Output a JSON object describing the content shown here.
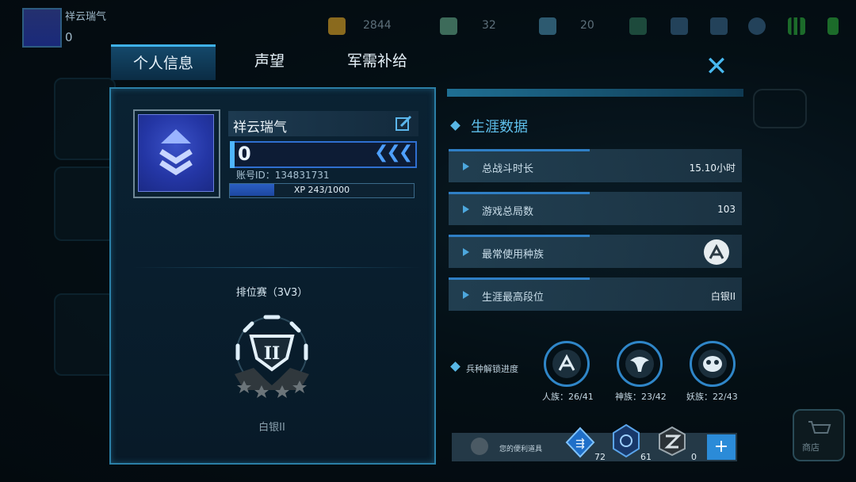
{
  "hud": {
    "player_name": "祥云瑞气",
    "level": "0",
    "resources": [
      {
        "icon": "gold-icon",
        "value": "2844"
      },
      {
        "icon": "crystal-icon",
        "value": "32"
      },
      {
        "icon": "hex-token-icon",
        "value": "20"
      }
    ]
  },
  "tabs": [
    {
      "label": "个人信息",
      "active": true
    },
    {
      "label": "声望",
      "active": false
    },
    {
      "label": "军需补给",
      "active": false
    }
  ],
  "profile": {
    "name": "祥云瑞气",
    "level": "0",
    "account_id": "账号ID：134831731",
    "xp_text": "XP 243/1000",
    "xp_fraction": 0.243
  },
  "ranked": {
    "title": "排位赛（3V3）",
    "rank": "白银II",
    "stars_filled": 0
  },
  "career": {
    "title": "生涯数据",
    "stats": [
      {
        "label": "总战斗时长",
        "value": "15.10小时"
      },
      {
        "label": "游戏总局数",
        "value": "103"
      },
      {
        "label": "最常使用种族",
        "value": ""
      },
      {
        "label": "生涯最高段位",
        "value": "白银II"
      }
    ]
  },
  "unlock": {
    "title": "兵种解锁进度",
    "races": [
      {
        "caption": "人族：26/41",
        "icon": "human-race-icon"
      },
      {
        "caption": "神族：23/42",
        "icon": "divine-race-icon"
      },
      {
        "caption": "妖族：22/43",
        "icon": "demon-race-icon"
      }
    ]
  },
  "convenience": {
    "label": "您的便利道具",
    "items": [
      {
        "icon": "speed-item-icon",
        "count": "72"
      },
      {
        "icon": "rune-item-icon",
        "count": "61"
      },
      {
        "icon": "link-item-icon",
        "count": "0"
      }
    ],
    "add_label": "+"
  },
  "shop_label": "商店",
  "colors": {
    "accent": "#3fb1e8",
    "panel_border": "#2b7fa6",
    "xp_fill": "#2a5ec2"
  }
}
